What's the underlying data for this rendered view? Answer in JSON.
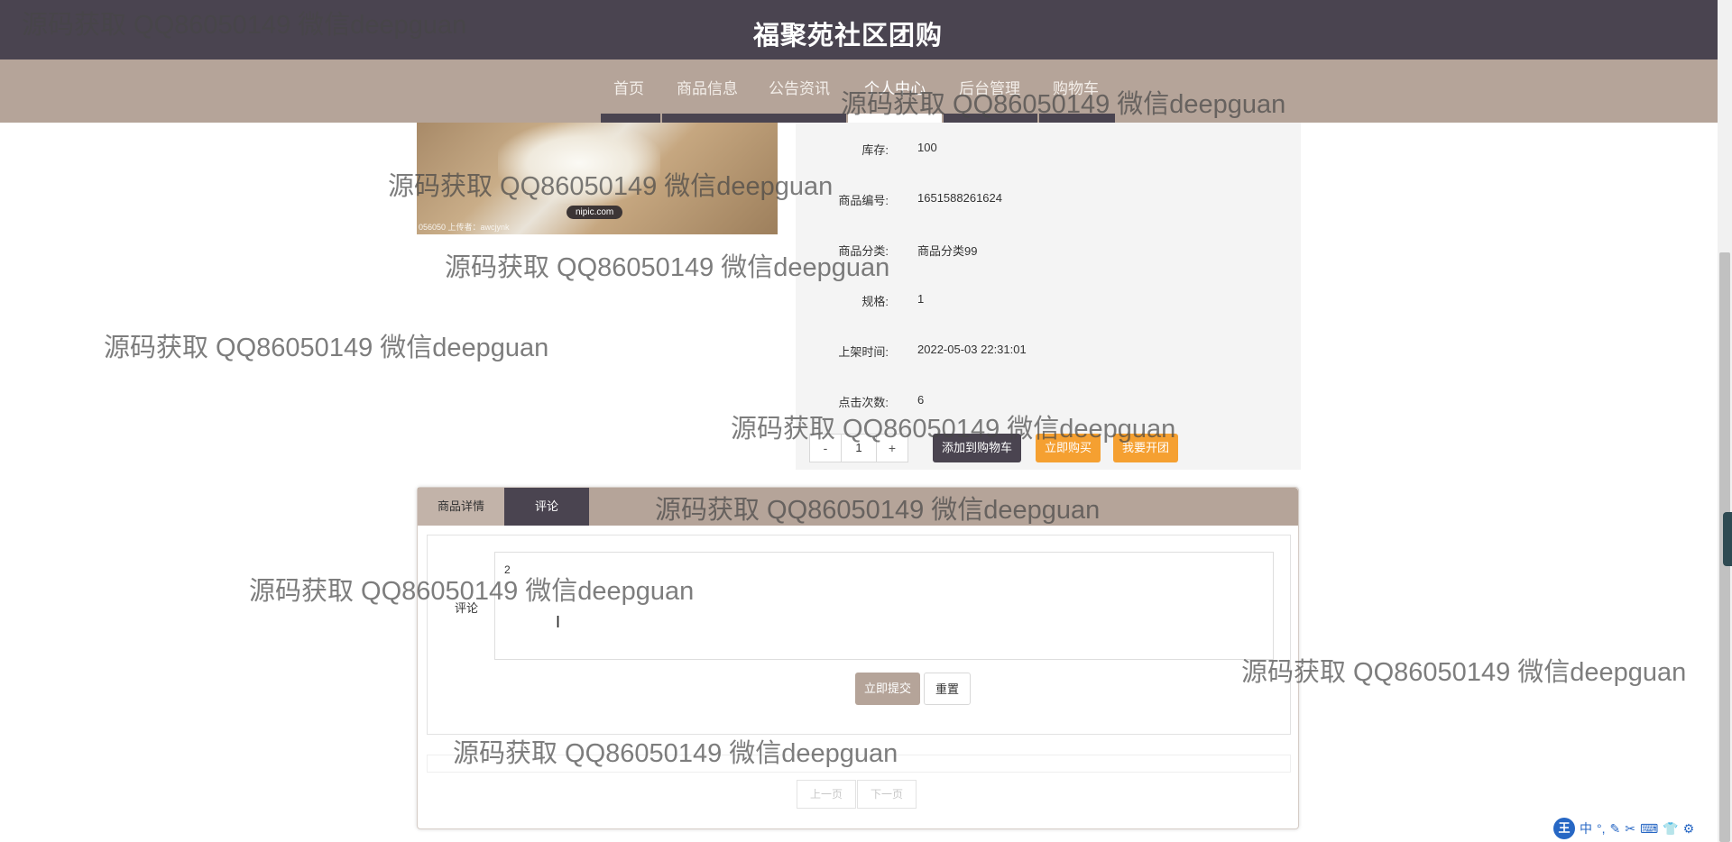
{
  "header": {
    "title": "福聚苑社区团购"
  },
  "nav": {
    "items": [
      {
        "label": "首页"
      },
      {
        "label": "商品信息"
      },
      {
        "label": "公告资讯"
      },
      {
        "label": "个人中心"
      },
      {
        "label": "后台管理"
      },
      {
        "label": "购物车"
      }
    ]
  },
  "product": {
    "image_caption": "056050 上传者：awcjynk",
    "image_badge": "nipic.com",
    "fields": [
      {
        "label": "库存:",
        "value": "100"
      },
      {
        "label": "商品编号:",
        "value": "1651588261624"
      },
      {
        "label": "商品分类:",
        "value": "商品分类99"
      },
      {
        "label": "规格:",
        "value": "1"
      },
      {
        "label": "上架时间:",
        "value": "2022-05-03 22:31:01"
      },
      {
        "label": "点击次数:",
        "value": "6"
      }
    ],
    "quantity": "1",
    "minus_label": "-",
    "plus_label": "+",
    "add_to_cart": "添加到购物车",
    "buy_now": "立即购买",
    "start_group": "我要开团"
  },
  "detail": {
    "tabs": [
      {
        "label": "商品详情"
      },
      {
        "label": "评论"
      }
    ],
    "comment_label": "评论",
    "comment_value": "2",
    "submit_label": "立即提交",
    "reset_label": "重置",
    "prev_label": "上一页",
    "next_label": "下一页"
  },
  "watermark": {
    "text": "源码获取 QQ86050149 微信deepguan"
  },
  "ime": {
    "logo": "王",
    "items": [
      "中",
      "°,",
      "✎",
      "✂",
      "⌨",
      "👕",
      "⚙"
    ]
  }
}
